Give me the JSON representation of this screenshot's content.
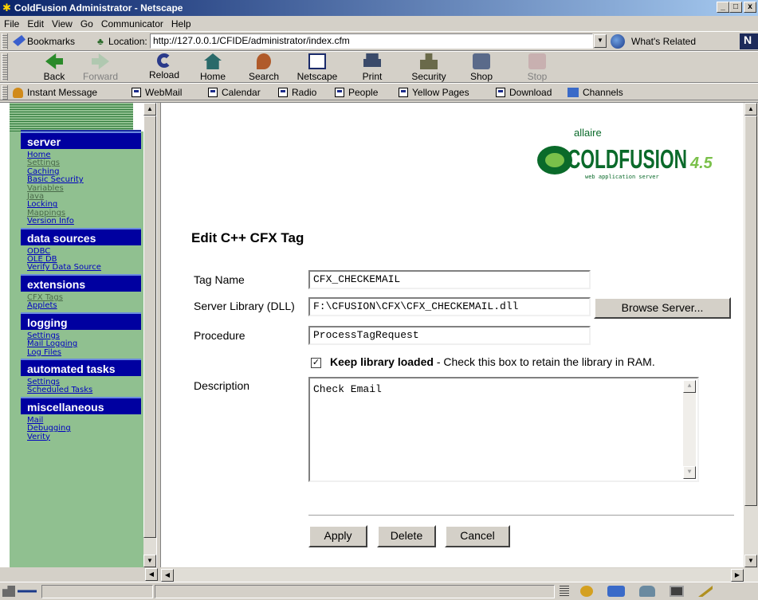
{
  "window": {
    "title": "ColdFusion Administrator - Netscape",
    "controls": [
      "_",
      "□",
      "x"
    ]
  },
  "menu": [
    "File",
    "Edit",
    "View",
    "Go",
    "Communicator",
    "Help"
  ],
  "location_bar": {
    "bookmarks_label": "Bookmarks",
    "location_label": "Location:",
    "url": "http://127.0.0.1/CFIDE/administrator/index.cfm",
    "related_label": "What's Related",
    "logo_letter": "N"
  },
  "toolbar": [
    {
      "label": "Back",
      "icon": "back-arrow-icon",
      "enabled": true
    },
    {
      "label": "Forward",
      "icon": "forward-arrow-icon",
      "enabled": false
    },
    {
      "label": "Reload",
      "icon": "reload-icon",
      "enabled": true
    },
    {
      "label": "Home",
      "icon": "home-icon",
      "enabled": true
    },
    {
      "label": "Search",
      "icon": "search-icon",
      "enabled": true
    },
    {
      "label": "Netscape",
      "icon": "netscape-icon",
      "enabled": true
    },
    {
      "label": "Print",
      "icon": "print-icon",
      "enabled": true
    },
    {
      "label": "Security",
      "icon": "lock-icon",
      "enabled": true
    },
    {
      "label": "Shop",
      "icon": "shop-icon",
      "enabled": true
    },
    {
      "label": "Stop",
      "icon": "stop-icon",
      "enabled": false
    }
  ],
  "personal_toolbar": [
    "Instant Message",
    "WebMail",
    "Calendar",
    "Radio",
    "People",
    "Yellow Pages",
    "Download",
    "Channels"
  ],
  "sidebar": {
    "sections": [
      {
        "title": "server",
        "links": [
          "Home",
          "Settings",
          "Caching",
          "Basic Security",
          "Variables",
          "Java",
          "Locking",
          "Mappings",
          "Version Info"
        ]
      },
      {
        "title": "data sources",
        "links": [
          "ODBC",
          "OLE DB",
          "Verify Data Source"
        ]
      },
      {
        "title": "extensions",
        "links": [
          "CFX Tags",
          "Applets"
        ]
      },
      {
        "title": "logging",
        "links": [
          "Settings",
          "Mail Logging",
          "Log Files"
        ]
      },
      {
        "title": "automated tasks",
        "links": [
          "Settings",
          "Scheduled Tasks"
        ]
      },
      {
        "title": "miscellaneous",
        "links": [
          "Mail",
          "Debugging",
          "Verity"
        ]
      }
    ]
  },
  "logo": {
    "brand_top": "allaire",
    "brand": "COLDFUSION",
    "version": "4.5",
    "tagline": "web application server"
  },
  "form": {
    "title": "Edit C++ CFX Tag",
    "tag_name_label": "Tag Name",
    "tag_name_value": "CFX_CHECKEMAIL",
    "library_label": "Server Library (DLL)",
    "library_value": "F:\\CFUSION\\CFX\\CFX_CHECKEMAIL.dll",
    "browse_label": "Browse Server...",
    "procedure_label": "Procedure",
    "procedure_value": "ProcessTagRequest",
    "keep_loaded_checked": true,
    "keep_loaded_check_mark": "✓",
    "keep_loaded_bold": "Keep library loaded",
    "keep_loaded_desc": " - Check this box to retain the library in RAM.",
    "description_label": "Description",
    "description_value": "Check Email",
    "apply_label": "Apply",
    "delete_label": "Delete",
    "cancel_label": "Cancel"
  }
}
